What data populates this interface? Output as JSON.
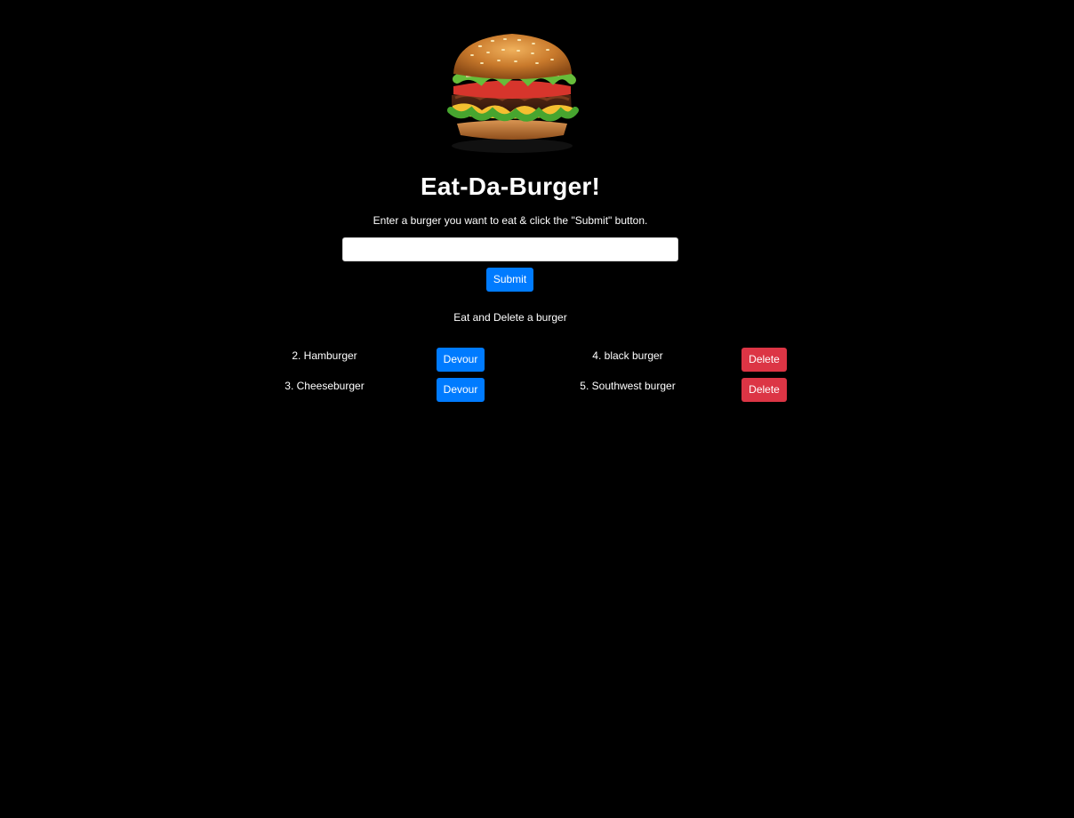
{
  "header": {
    "image_label": "burger-image",
    "title": "Eat-Da-Burger!",
    "instructions": "Enter a burger you want to eat & click the \"Submit\" button."
  },
  "form": {
    "input_value": "",
    "input_placeholder": "",
    "submit_label": "Submit"
  },
  "lists": {
    "section_title": "Eat and Delete a burger",
    "to_eat": [
      {
        "label": "2. Hamburger",
        "action_label": "Devour"
      },
      {
        "label": "3. Cheeseburger",
        "action_label": "Devour"
      }
    ],
    "eaten": [
      {
        "label": "4. black burger",
        "action_label": "Delete"
      },
      {
        "label": "5. Southwest burger",
        "action_label": "Delete"
      }
    ]
  },
  "colors": {
    "page_background": "#000000",
    "primary_button": "#007bff",
    "danger_button": "#dc3545",
    "text": "#ffffff"
  }
}
